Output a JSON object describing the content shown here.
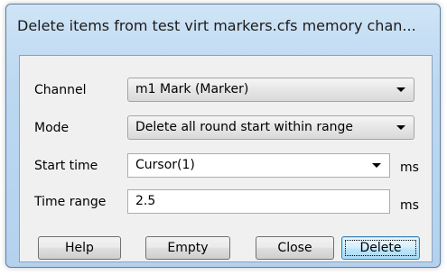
{
  "window": {
    "title": "Delete items from test virt markers.cfs memory chan..."
  },
  "form": {
    "channel_label": "Channel",
    "channel_value": "m1 Mark (Marker)",
    "mode_label": "Mode",
    "mode_value": "Delete all round start within range",
    "start_time_label": "Start time",
    "start_time_value": "Cursor(1)",
    "start_time_unit": "ms",
    "time_range_label": "Time range",
    "time_range_value": "2.5",
    "time_range_unit": "ms"
  },
  "buttons": {
    "help": "Help",
    "empty": "Empty",
    "close": "Close",
    "delete": "Delete"
  },
  "icons": {
    "dropdown": "chevron-down-icon"
  },
  "colors": {
    "titlebar": "#bcd8f1",
    "client_bg": "#f0f0f0",
    "default_button": "#bee6fd"
  }
}
